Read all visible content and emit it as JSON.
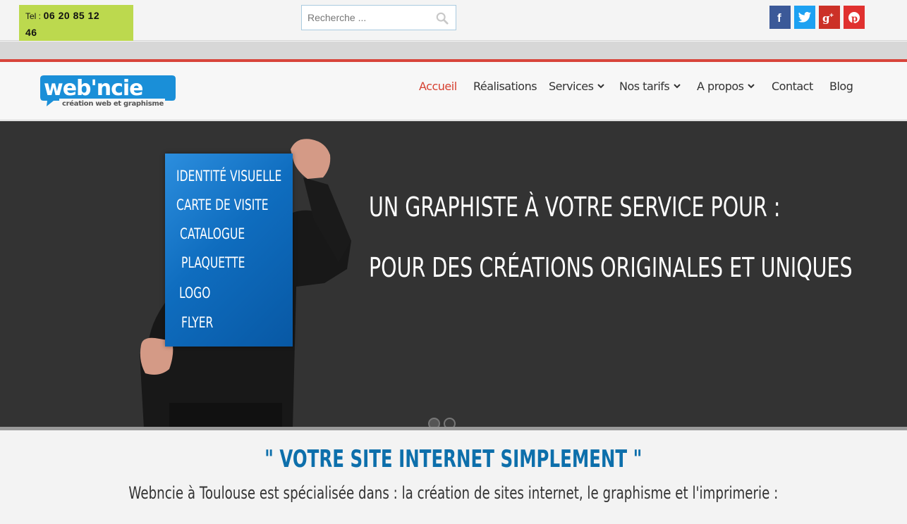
{
  "topbar": {
    "phone_label": "Tel :",
    "phone_number_line1": "06 20 85 12",
    "phone_number_line2": "46",
    "search_placeholder": "Recherche ...",
    "social": [
      {
        "icon": "facebook-icon",
        "glyph": "f",
        "color": "#3b5998"
      },
      {
        "icon": "twitter-icon",
        "glyph": "t",
        "color": "#1da1f2"
      },
      {
        "icon": "google-plus-icon",
        "glyph": "g+",
        "color": "#cc3127"
      },
      {
        "icon": "pinterest-icon",
        "glyph": "p",
        "color": "#e0312f"
      }
    ]
  },
  "logo": {
    "name": "web'ncie",
    "tagline": "création web et graphisme",
    "color": "#1a8fd8"
  },
  "nav": {
    "items": [
      {
        "label": "Accueil",
        "active": true
      },
      {
        "label": "Réalisations"
      },
      {
        "label": "Services",
        "dropdown": true
      },
      {
        "label": "Nos tarifs",
        "dropdown": true
      },
      {
        "label": "A propos",
        "dropdown": true
      },
      {
        "label": "Contact"
      },
      {
        "label": "Blog"
      }
    ],
    "active_color": "#d64030"
  },
  "hero": {
    "poster_items": [
      "IDENTITÉ VISUELLE",
      "CARTE DE VISITE",
      "CATALOGUE",
      "PLAQUETTE",
      "LOGO",
      "FLYER"
    ],
    "line1": "UN GRAPHISTE À VOTRE SERVICE POUR :",
    "line2": "POUR DES CRÉATIONS ORIGINALES ET UNIQUES",
    "slides": 2,
    "active_slide": 1
  },
  "intro": {
    "tagline": "\" VOTRE SITE INTERNET SIMPLEMENT \"",
    "text": "Webncie à Toulouse est spécialisée dans : la création de sites internet,  le graphisme et l'imprimerie :",
    "accent": "#0d6fab"
  }
}
